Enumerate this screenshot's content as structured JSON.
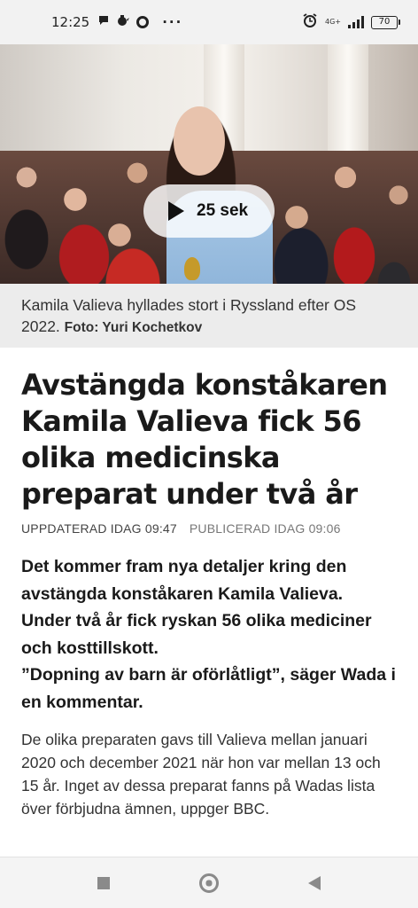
{
  "status_bar": {
    "time": "12:25",
    "network": "4G+",
    "battery": "70"
  },
  "video": {
    "duration_label": "25 sek"
  },
  "caption": {
    "text": "Kamila Valieva hyllades stort i Ryssland efter OS 2022.",
    "credit": "Foto: Yuri Kochetkov"
  },
  "article": {
    "headline": "Avstängda konståkaren Kamila Valieva fick 56 olika medicinska preparat under två år",
    "updated": "UPPDATERAD IDAG 09:47",
    "published": "PUBLICERAD IDAG 09:06",
    "lead_1": "Det kommer fram nya detaljer kring den avstängda konståkaren Kamila Valieva. Under två år fick ryskan 56 olika mediciner och kosttillskott.",
    "lead_2": "”Dopning av barn är oförlåtligt”, säger Wada i en kommentar.",
    "body": "De olika preparaten gavs till Valieva mellan januari 2020 och december 2021 när hon var mellan 13 och 15 år. Inget av dessa preparat fanns på Wadas lista över förbjudna ämnen, uppger BBC."
  }
}
